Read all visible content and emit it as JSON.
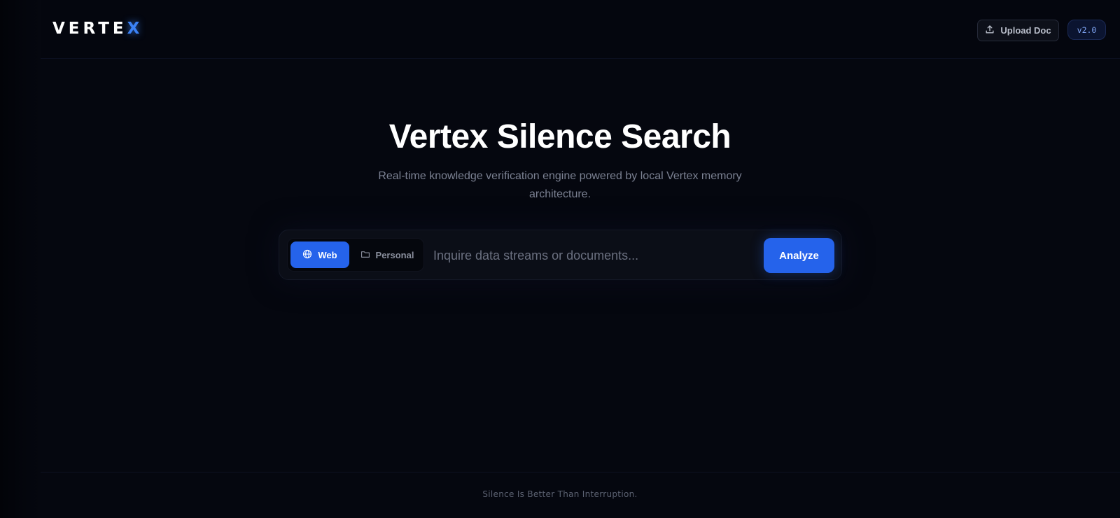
{
  "header": {
    "logo_text": "VERTE",
    "logo_accent": "X",
    "upload_label": "Upload Doc",
    "version": "v2.0"
  },
  "hero": {
    "title": "Vertex Silence Search",
    "subtitle": "Real-time knowledge verification engine powered by local Vertex memory architecture."
  },
  "search": {
    "modes": [
      {
        "label": "Web",
        "icon": "globe-icon",
        "active": true
      },
      {
        "label": "Personal",
        "icon": "folder-icon",
        "active": false
      }
    ],
    "placeholder": "Inquire data streams or documents...",
    "value": "",
    "submit_label": "Analyze"
  },
  "footer": {
    "tagline": "Silence Is Better Than Interruption."
  },
  "colors": {
    "background": "#05070f",
    "accent": "#2563eb",
    "logo_accent": "#3b82f6"
  }
}
